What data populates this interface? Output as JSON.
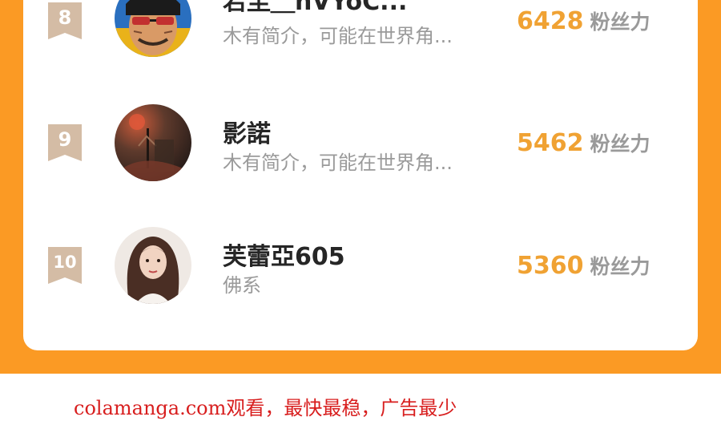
{
  "leaderboard": {
    "entries": [
      {
        "rank": "8",
        "name": "若尘＿nVYoC...",
        "bio": "木有简介，可能在世界角...",
        "fans": "6428",
        "fans_unit": "粉丝力"
      },
      {
        "rank": "9",
        "name": "影諾",
        "bio": "木有简介，可能在世界角...",
        "fans": "5462",
        "fans_unit": "粉丝力"
      },
      {
        "rank": "10",
        "name": "芙蕾亞605",
        "bio": "佛系",
        "fans": "5360",
        "fans_unit": "粉丝力"
      }
    ]
  },
  "footer": {
    "text": "colamanga.com观看，最快最稳，广告最少"
  },
  "colors": {
    "page_orange": "#fb9a24",
    "fans_orange": "#f0a233",
    "badge_tan": "#d4bca5",
    "footer_red": "#d81e1e"
  }
}
